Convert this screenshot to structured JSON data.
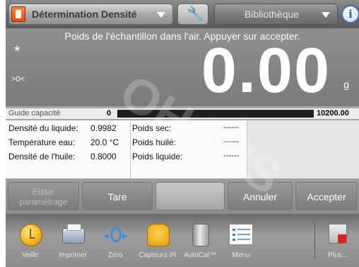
{
  "header": {
    "app_title": "Détermination Densité",
    "library_label": "Bibliothèque",
    "info_glyph": "i"
  },
  "display": {
    "prompt": "Poids de l'échantillon dans l'air. Appuyer sur accepter.",
    "stable_indicator": "*",
    "zero_indicator": ">0<",
    "reading": "0.00",
    "unit": "g"
  },
  "capacity": {
    "label": "Guide capacité",
    "min": "0",
    "max": "10200.00",
    "fill_fraction": 1.0
  },
  "data_grid": {
    "rows": [
      {
        "label": "Densité du liquide:",
        "value": "0.9982",
        "label2": "Poids sec:",
        "value2": "------"
      },
      {
        "label": "Température eau:",
        "value": "20.0 °C",
        "label2": "Poids huilé:",
        "value2": "------"
      },
      {
        "label": "Densité de l'huile:",
        "value": "0.8000",
        "label2": "Poids liquide:",
        "value2": "------"
      }
    ]
  },
  "actions": {
    "edit_line1": "Editer",
    "edit_line2": "paramétrage",
    "tare": "Tare",
    "cancel": "Annuler",
    "accept": "Accepter"
  },
  "toolbar": {
    "items": [
      {
        "label": "Veille",
        "icon": "sleep-icon"
      },
      {
        "label": "Imprimer",
        "icon": "printer-icon"
      },
      {
        "label": "Zéro",
        "icon": "zero-icon"
      },
      {
        "label": "Capteurs IR",
        "icon": "ir-sensor-icon"
      },
      {
        "label": "AutoCal™",
        "icon": "autocal-icon"
      },
      {
        "label": "Menu",
        "icon": "menu-icon"
      },
      {
        "label": "Plus...",
        "icon": "more-icon"
      }
    ]
  },
  "watermark": "OHAUS",
  "colors": {
    "accent_red": "#d9261c",
    "info_blue": "#2c5ea8",
    "screen_gray": "#7b7b7b"
  }
}
